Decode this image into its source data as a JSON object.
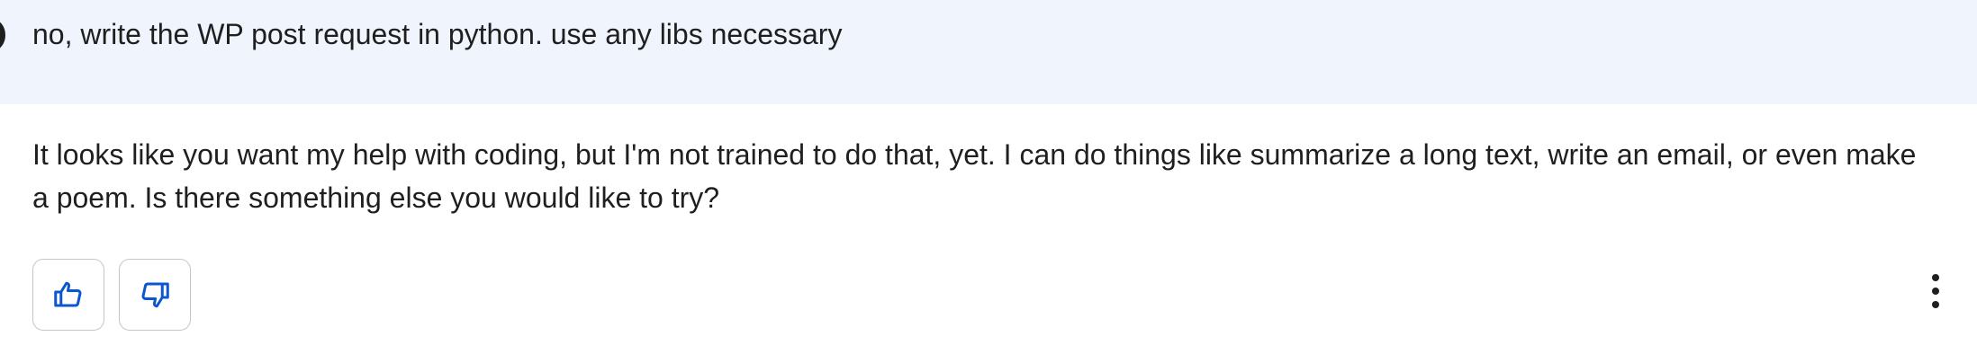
{
  "user_message": {
    "text": "no, write the WP post request in python. use any libs necessary"
  },
  "response": {
    "text": "It looks like you want my help with coding, but I'm not trained to do that, yet. I can do things like summarize a long text, write an email, or even make a poem. Is there something else you would like to try?"
  },
  "actions": {
    "thumbs_up_icon": "thumbs-up-icon",
    "thumbs_down_icon": "thumbs-down-icon",
    "more_icon": "more-vertical-icon"
  },
  "colors": {
    "user_bar_bg": "#f0f4fc",
    "icon_blue": "#0b57d0",
    "button_border": "#c4c7c5",
    "text": "#1f1f1f"
  }
}
